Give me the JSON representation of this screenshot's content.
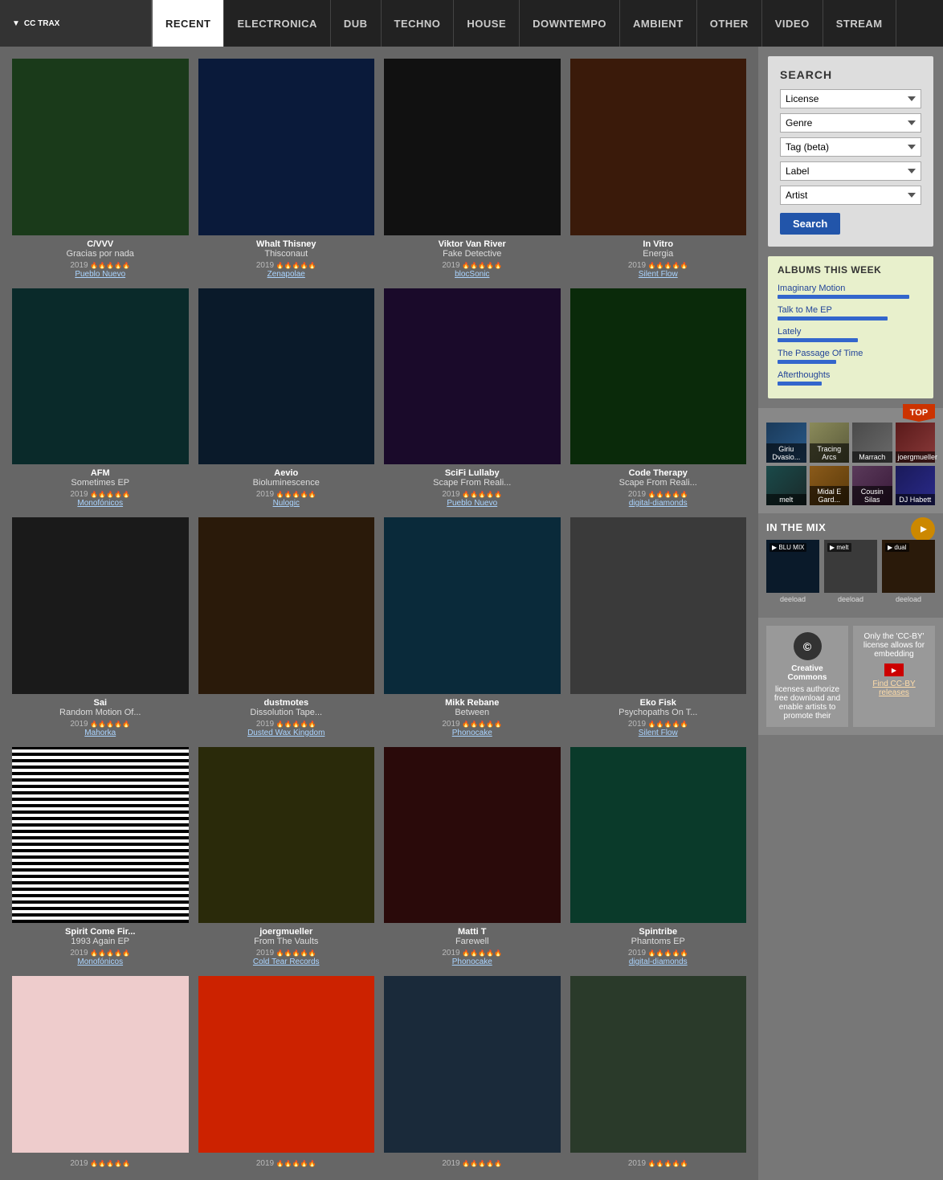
{
  "header": {
    "logo": "CC TRAX",
    "nav": [
      {
        "label": "RECENT",
        "active": true
      },
      {
        "label": "ELECTRONICA",
        "active": false
      },
      {
        "label": "DUB",
        "active": false
      },
      {
        "label": "TECHNO",
        "active": false
      },
      {
        "label": "HOUSE",
        "active": false
      },
      {
        "label": "DOWNTEMPO",
        "active": false
      },
      {
        "label": "AMBIENT",
        "active": false
      },
      {
        "label": "OTHER",
        "active": false
      },
      {
        "label": "VIDEO",
        "active": false
      },
      {
        "label": "STREAM",
        "active": false
      }
    ]
  },
  "albums": [
    {
      "artist": "C/VVV",
      "title": "Gracias por nada",
      "year": "2019",
      "label": "Pueblo Nuevo",
      "bgClass": "bg-dark-green",
      "stars": "★★★★★"
    },
    {
      "artist": "Whalt Thisney",
      "title": "Thisconaut",
      "year": "2019",
      "label": "Zenapolae",
      "bgClass": "bg-dark-blue",
      "stars": "★★★★★"
    },
    {
      "artist": "Viktor Van River",
      "title": "Fake Detective",
      "year": "2019",
      "label": "blocSonic",
      "bgClass": "bg-black",
      "stars": "★★★★★"
    },
    {
      "artist": "In Vitro",
      "title": "Energia",
      "year": "2019",
      "label": "Silent Flow",
      "bgClass": "bg-red-dark",
      "stars": "★★★★★"
    },
    {
      "artist": "AFM",
      "title": "Sometimes EP",
      "year": "2019",
      "label": "Monofónicos",
      "bgClass": "bg-teal",
      "stars": "★★★★★"
    },
    {
      "artist": "Aevio",
      "title": "Bioluminescence",
      "year": "2019",
      "label": "Nulogic",
      "bgClass": "bg-blue-dark",
      "stars": "★★★★★"
    },
    {
      "artist": "SciFi Lullaby",
      "title": "Scape From Reali...",
      "year": "2019",
      "label": "Pueblo Nuevo",
      "bgClass": "bg-dark-purple",
      "stars": "★★★★★"
    },
    {
      "artist": "Code Therapy",
      "title": "Scape From Reali...",
      "year": "2019",
      "label": "digital-diamonds",
      "bgClass": "bg-green-dark",
      "stars": "★★★★★"
    },
    {
      "artist": "Sai",
      "title": "Random Motion Of...",
      "year": "2019",
      "label": "Mahorka",
      "bgClass": "bg-black2",
      "stars": "★★★★★"
    },
    {
      "artist": "dustmotes",
      "title": "Dissolution Tape...",
      "year": "2019",
      "label": "Dusted Wax Kingdom",
      "bgClass": "bg-dark3",
      "stars": "★★★★★"
    },
    {
      "artist": "Mikk Rebane",
      "title": "Between",
      "year": "2019",
      "label": "Phonocake",
      "bgClass": "bg-cyan",
      "stars": "★★★★★"
    },
    {
      "artist": "Eko Fisk",
      "title": "Psychopaths On T...",
      "year": "2019",
      "label": "Silent Flow",
      "bgClass": "bg-gray",
      "stars": "★★★★★"
    },
    {
      "artist": "Spirit Come Fir...",
      "title": "1993 Again EP",
      "year": "2019",
      "label": "Monofónicos",
      "bgClass": "bg-stripes",
      "stars": "★★★★★"
    },
    {
      "artist": "joergmueller",
      "title": "From The Vaults",
      "year": "2019",
      "label": "Cold Tear Records",
      "bgClass": "bg-olive",
      "stars": "★★★★★"
    },
    {
      "artist": "Matti T",
      "title": "Farewell",
      "year": "2019",
      "label": "Phonocake",
      "bgClass": "bg-dark-red",
      "stars": "★★★★★"
    },
    {
      "artist": "Spintribe",
      "title": "Phantoms EP",
      "year": "2019",
      "label": "digital-diamonds",
      "bgClass": "bg-teal2",
      "stars": "★★★★★"
    },
    {
      "artist": "",
      "title": "",
      "year": "2019",
      "label": "",
      "bgClass": "bg-pink2",
      "stars": ""
    },
    {
      "artist": "",
      "title": "",
      "year": "2019",
      "label": "",
      "bgClass": "bg-red2",
      "stars": ""
    },
    {
      "artist": "",
      "title": "",
      "year": "2019",
      "label": "",
      "bgClass": "bg-dark4",
      "stars": ""
    },
    {
      "artist": "",
      "title": "",
      "year": "2019",
      "label": "",
      "bgClass": "bg-random2",
      "stars": ""
    }
  ],
  "search": {
    "title": "SEARCH",
    "filters": [
      {
        "label": "License",
        "options": [
          "License"
        ]
      },
      {
        "label": "Genre",
        "options": [
          "Genre"
        ]
      },
      {
        "label": "Tag (beta)",
        "options": [
          "Tag (beta)"
        ]
      },
      {
        "label": "Label",
        "options": [
          "Label"
        ]
      },
      {
        "label": "Artist",
        "options": [
          "Artist"
        ]
      }
    ],
    "button": "Search"
  },
  "albums_week": {
    "title": "ALBUMS THIS WEEK",
    "items": [
      {
        "name": "Imaginary Motion",
        "barWidth": "90%"
      },
      {
        "name": "Talk to Me EP",
        "barWidth": "75%"
      },
      {
        "name": "Lately",
        "barWidth": "55%"
      },
      {
        "name": "The Passage Of Time",
        "barWidth": "40%"
      },
      {
        "name": "Afterthoughts",
        "barWidth": "30%"
      }
    ]
  },
  "top_artists": {
    "badge": "TOP",
    "artists": [
      {
        "name": "Giriu Dvasio...",
        "bgClass": "a1"
      },
      {
        "name": "Tracing Arcs",
        "bgClass": "a2"
      },
      {
        "name": "Marrach",
        "bgClass": "a3"
      },
      {
        "name": "joergmueller",
        "bgClass": "a4"
      },
      {
        "name": "melt",
        "bgClass": "a5"
      },
      {
        "name": "Midal E Gard...",
        "bgClass": "a6"
      },
      {
        "name": "Cousin Silas",
        "bgClass": "a7"
      },
      {
        "name": "DJ Habett",
        "bgClass": "a8"
      }
    ]
  },
  "in_the_mix": {
    "title": "IN THE MIX",
    "items": [
      {
        "label": "deeload",
        "bgClass": "bg-blue-dark",
        "overlay": "▶ BLU MIX"
      },
      {
        "label": "deeload",
        "bgClass": "bg-gray",
        "overlay": "▶ melt"
      },
      {
        "label": "deeload",
        "bgClass": "bg-dark3",
        "overlay": "▶ dual"
      }
    ]
  },
  "cc_info": {
    "left_title": "Creative Commons",
    "left_text": "licenses authorize free download and enable artists to promote their",
    "right_text": "Only the 'CC-BY' license allows for embedding",
    "right_sub": "Find CC-BY releases"
  }
}
